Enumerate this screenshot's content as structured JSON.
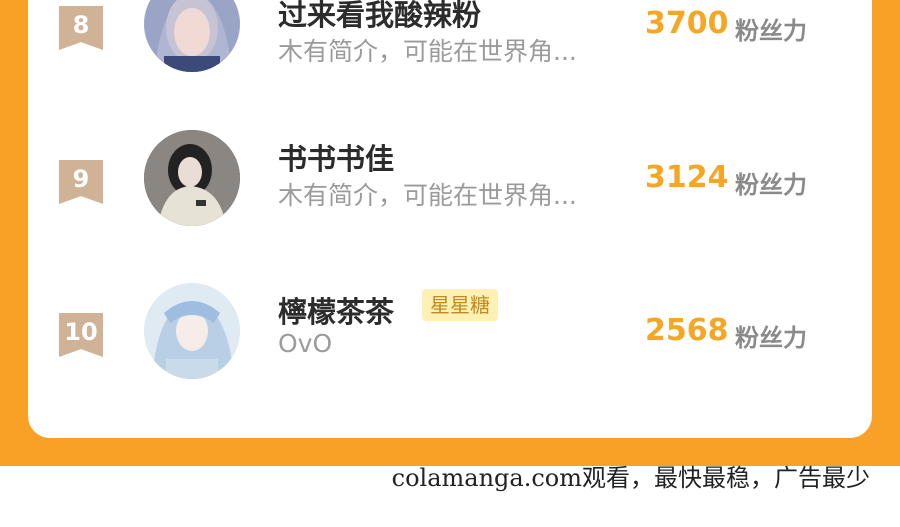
{
  "leaderboard": {
    "rows": [
      {
        "rank": "8",
        "name": "过来看我酸辣粉",
        "badge": "",
        "desc": "木有简介，可能在世界角...",
        "count": "3700",
        "unit": "粉丝力"
      },
      {
        "rank": "9",
        "name": "书书书佳",
        "badge": "",
        "desc": "木有简介，可能在世界角...",
        "count": "3124",
        "unit": "粉丝力"
      },
      {
        "rank": "10",
        "name": "檸檬茶茶",
        "badge": "星星糖",
        "desc": "OvO",
        "count": "2568",
        "unit": "粉丝力"
      }
    ]
  },
  "watermark": "colamanga.com观看，最快最稳，广告最少",
  "colors": {
    "frame": "#f9a026",
    "count": "#f5a624",
    "rank_ribbon": "#d0b296",
    "badge_bg": "#fff0b3"
  }
}
